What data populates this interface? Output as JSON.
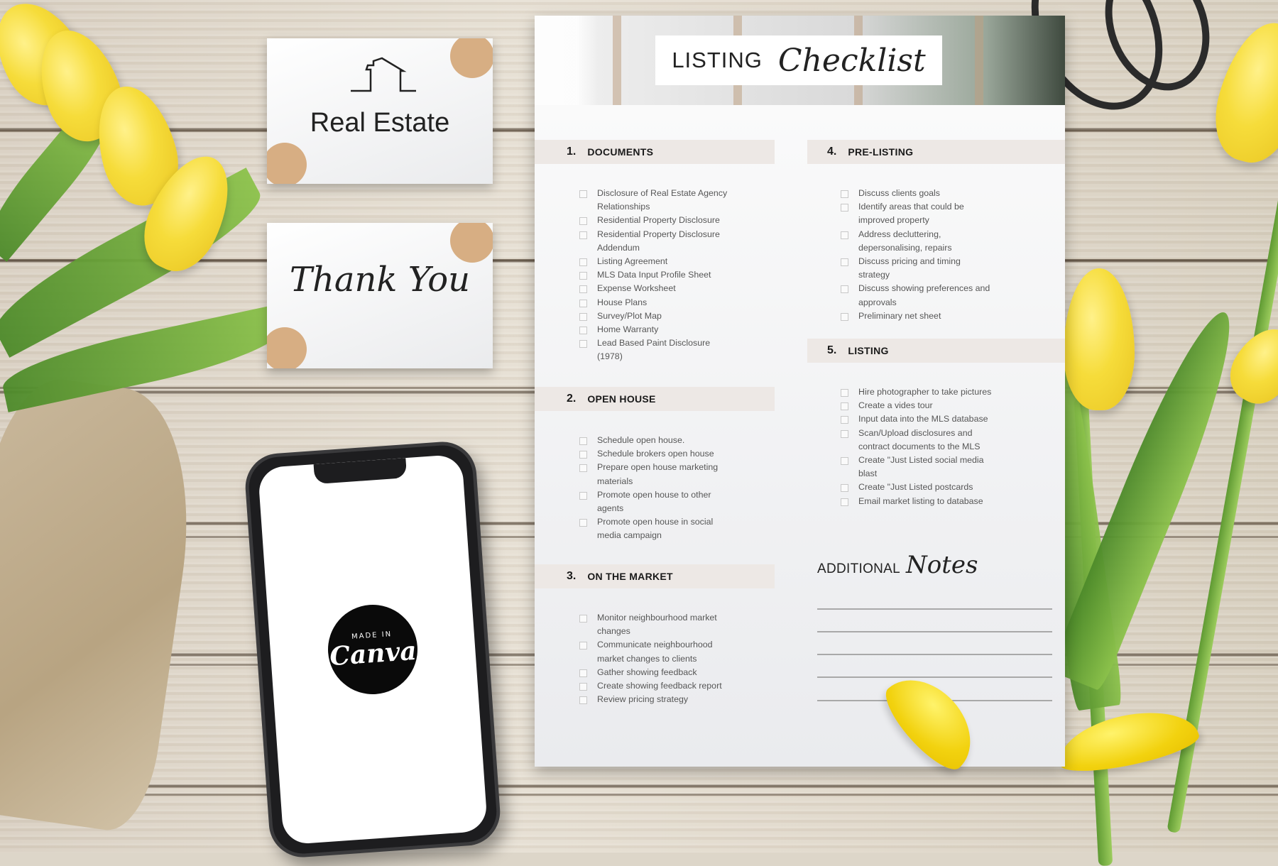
{
  "scene": {
    "description": "Flat-lay mockup of real estate templates on a wooden table with yellow tulips",
    "colors": {
      "wood": "#ddd6c9",
      "tulip": "#f6dc3a",
      "card_accent": "#d7ae83",
      "section_band": "#ede8e5",
      "phone": "#1d1d1f"
    }
  },
  "cards": {
    "real_estate": {
      "title": "Real Estate",
      "icon": "house-outline-icon"
    },
    "thank_you": {
      "title": "Thank You"
    }
  },
  "phone": {
    "badge_small": "MADE IN",
    "badge_big": "Canva"
  },
  "checklist": {
    "title_word": "LISTING",
    "title_script": "Checklist",
    "sections": [
      {
        "number": "1.",
        "title": "DOCUMENTS",
        "items": [
          "Disclosure of Real Estate Agency Relationships",
          "Residential Property Disclosure",
          "Residential Property Disclosure Addendum",
          "Listing Agreement",
          "MLS Data Input Profile Sheet",
          "Expense Worksheet",
          "House Plans",
          "Survey/Plot Map",
          "Home Warranty",
          "Lead Based Paint Disclosure (1978)"
        ]
      },
      {
        "number": "2.",
        "title": "OPEN HOUSE",
        "items": [
          "Schedule open house.",
          "Schedule brokers open house",
          "Prepare open house marketing materials",
          "Promote open house to other agents",
          "Promote open house in social media campaign"
        ]
      },
      {
        "number": "3.",
        "title": "ON THE MARKET",
        "items": [
          "Monitor neighbourhood market changes",
          "Communicate neighbourhood market changes to clients",
          "Gather showing feedback",
          "Create showing feedback report",
          "Review pricing strategy"
        ]
      },
      {
        "number": "4.",
        "title": "PRE-LISTING",
        "items": [
          "Discuss clients goals",
          "Identify areas that could be improved property",
          "Address decluttering, depersonalising, repairs",
          "Discuss pricing and timing strategy",
          "Discuss showing preferences and approvals",
          "Preliminary net sheet"
        ]
      },
      {
        "number": "5.",
        "title": "LISTING",
        "items": [
          "Hire photographer to take pictures",
          "Create a vides tour",
          "Input data into the MLS database",
          "Scan/Upload disclosures and contract documents to the MLS",
          "Create \"Just Listed social media blast",
          "Create \"Just Listed postcards",
          "Email market listing to database"
        ]
      }
    ],
    "notes": {
      "word": "ADDITIONAL",
      "script": "Notes",
      "line_count": 5
    }
  }
}
